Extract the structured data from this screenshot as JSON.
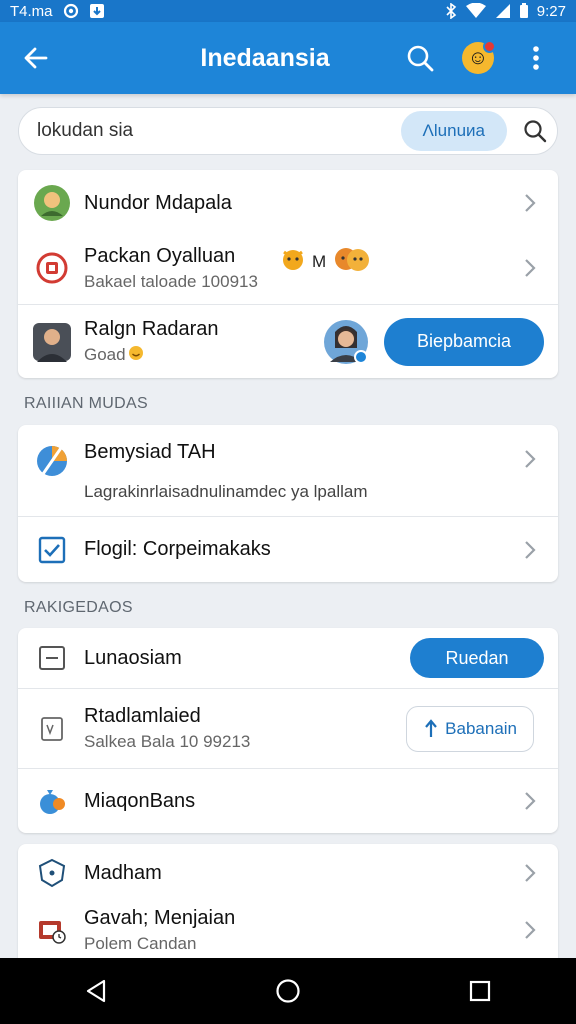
{
  "status_bar": {
    "time_left": "T4.ma",
    "time_right": "9:27"
  },
  "app_bar": {
    "title": "Inedaansia"
  },
  "search": {
    "query": "lokudan sia",
    "chip_label": "Λlunuиa"
  },
  "card1": {
    "row1": {
      "title": "Nundor Mdapala"
    },
    "row2": {
      "title": "Packan Oyalluan",
      "subtitle": "Bakael taloade 100913",
      "badge_text": "M"
    },
    "row3": {
      "title": "Ralgn Radaran",
      "subtitle": "Goad",
      "button_label": "Biepbamcia"
    }
  },
  "section1": {
    "label": "RAIIIAN MUDAS"
  },
  "card2": {
    "row1": {
      "title": "Bemysiad TAH",
      "subtitle": "Lagrakinrlaisadnulinamdec ya lpallam"
    },
    "row2": {
      "title": "Flogil: Corpeimakaks"
    }
  },
  "section2": {
    "label": "RAKIGEDAOS"
  },
  "card3": {
    "row1": {
      "title": "Lunaosiam",
      "button_label": "Ruedan"
    },
    "row2": {
      "title": "Rtadlamlaied",
      "subtitle": "Salkea Bala 10 99213",
      "button_label": "Babanain"
    },
    "row3": {
      "title": "MiaqonBans"
    }
  },
  "card4": {
    "row1": {
      "title": "Madham"
    },
    "row2": {
      "title": "Gavah; Menjaian",
      "subtitle": "Polem Candan"
    }
  },
  "colors": {
    "primary": "#1e85d8",
    "accent_button": "#1e7fd0",
    "background": "#eceff3"
  }
}
